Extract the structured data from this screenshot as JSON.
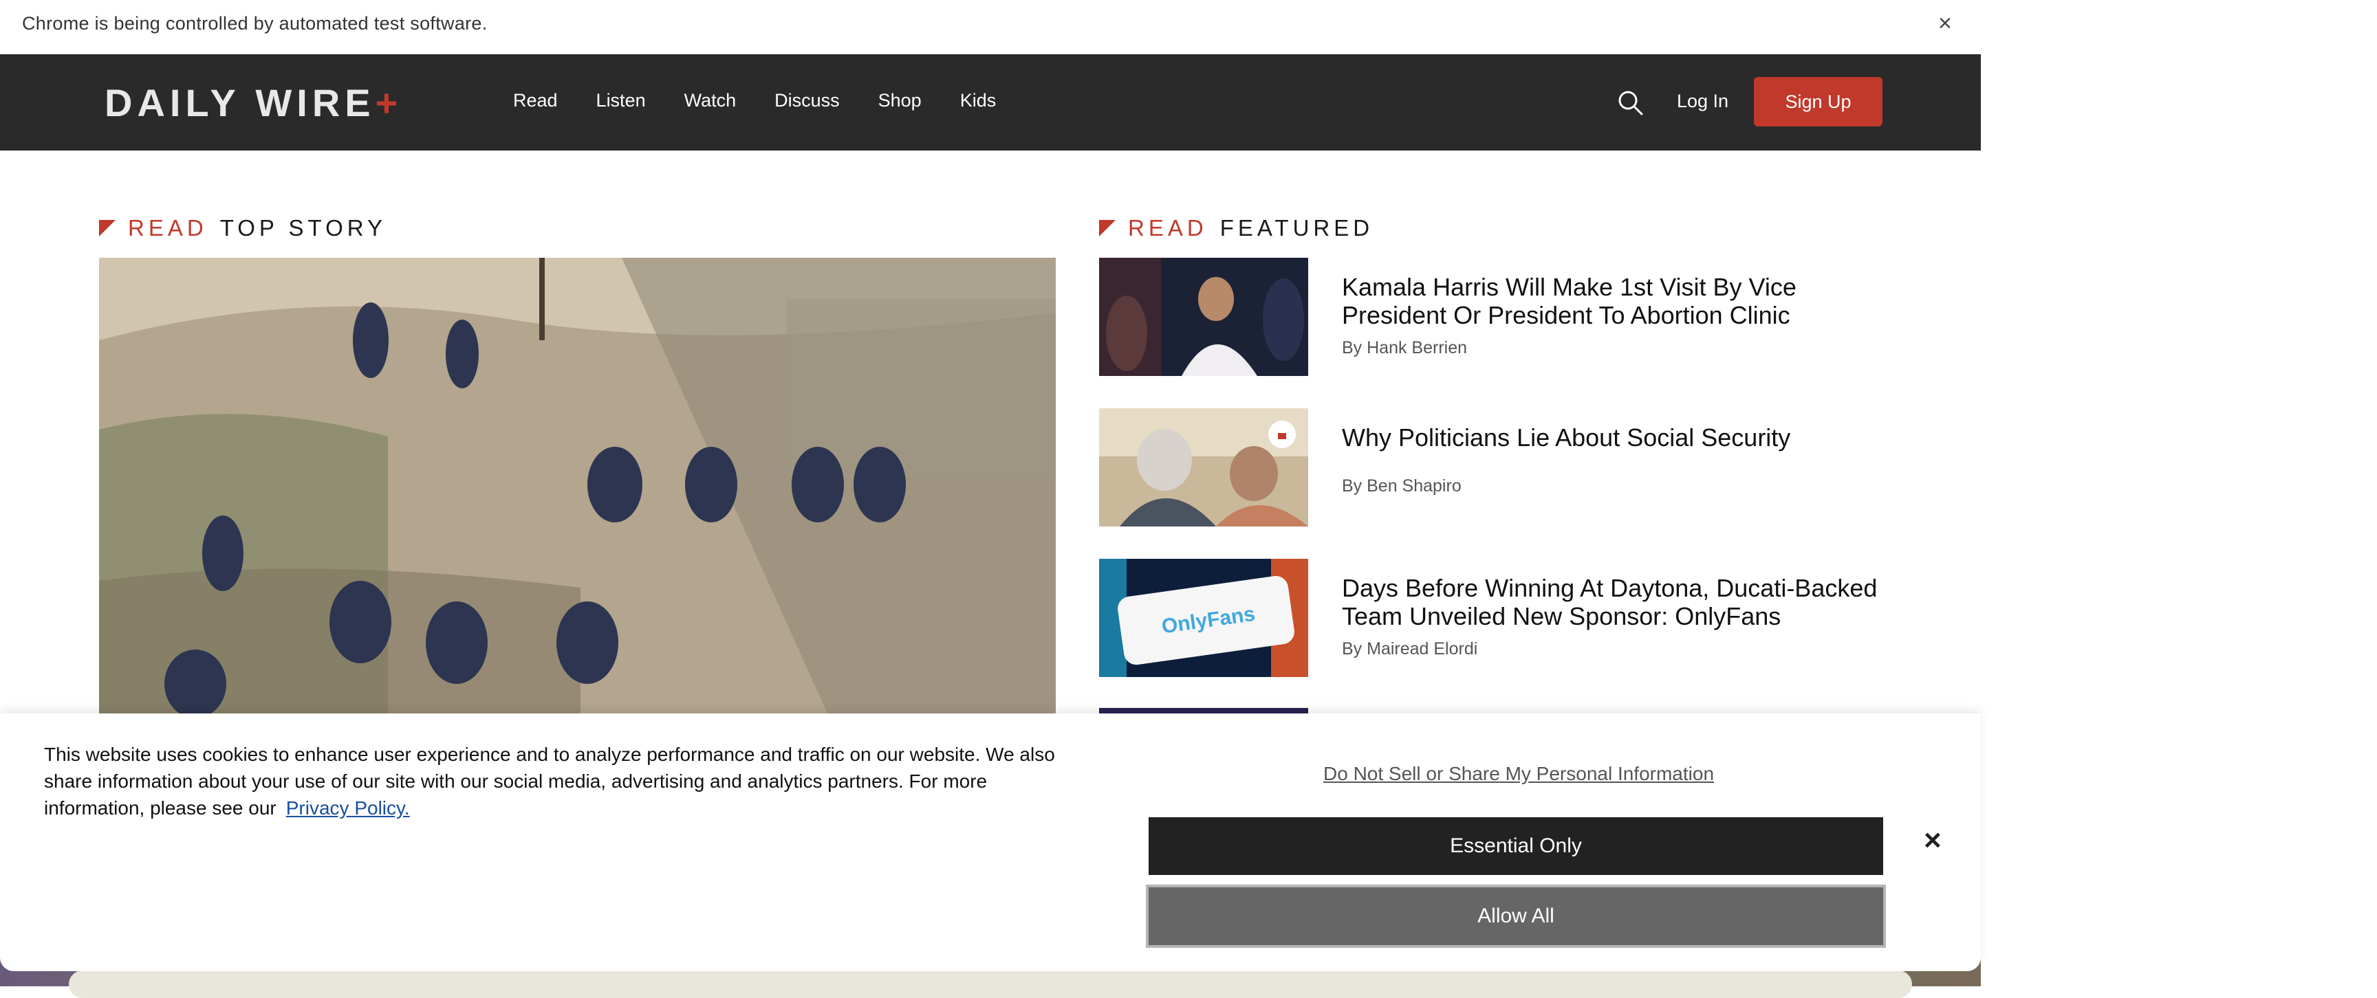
{
  "infobar": {
    "message": "Chrome is being controlled by automated test software.",
    "close": "×"
  },
  "header": {
    "logo_text": "DAILY WIRE",
    "logo_plus": "+",
    "nav": [
      "Read",
      "Listen",
      "Watch",
      "Discuss",
      "Shop",
      "Kids"
    ],
    "login": "Log In",
    "signup": "Sign Up",
    "accent_color": "#c0392b"
  },
  "top_story": {
    "kicker": "READ",
    "title": "TOP STORY"
  },
  "featured": {
    "kicker": "READ",
    "title": "FEATURED",
    "items": [
      {
        "title": "Kamala Harris Will Make 1st Visit By Vice President Or President To Abortion Clinic",
        "byline": "By Hank Berrien"
      },
      {
        "title": "Why Politicians Lie About Social Security",
        "byline": "By Ben Shapiro"
      },
      {
        "title": "Days Before Winning At Daytona, Ducati-Backed Team Unveiled New Sponsor: OnlyFans",
        "byline": "By Mairead Elordi"
      }
    ]
  },
  "cookie_banner": {
    "text": "This website uses cookies to enhance user experience and to analyze performance and traffic on our website. We also share information about your use of our site with our social media, advertising and analytics partners. For more information, please see our",
    "privacy_link": "Privacy Policy.",
    "do_not_sell": "Do Not Sell or Share My Personal Information",
    "essential_only": "Essential Only",
    "allow_all": "Allow All",
    "close": "×"
  }
}
